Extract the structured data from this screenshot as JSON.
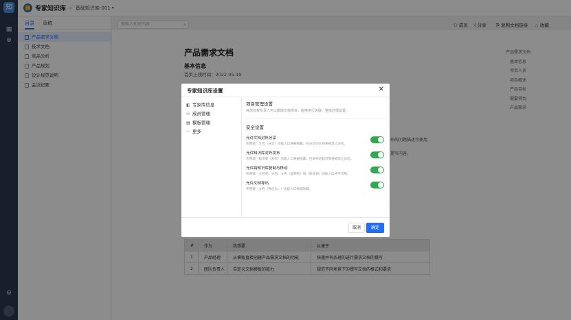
{
  "app": {
    "title": "专家知识库",
    "breadcrumb": "基础知识库-001",
    "caret": "▾"
  },
  "rail": {
    "logo": "知",
    "icons": [
      "grid-icon",
      "plus-icon",
      "settings-icon"
    ]
  },
  "leftpanel": {
    "tabs": [
      "目录",
      "草稿"
    ],
    "items": [
      "产品需求文档",
      "技术文档",
      "竞品分析",
      "产品规划",
      "设计规范说明",
      "会议纪要"
    ]
  },
  "toolbar": {
    "search_placeholder": "搜索入知识内容",
    "buttons": [
      "成员",
      "分享",
      "复制文档链接",
      "收藏"
    ]
  },
  "doc": {
    "title": "产品需求文档",
    "section": "基本信息",
    "meta": "首页上线时间：2022-05-19",
    "frag1": "外的问题描述可使用",
    "frag2": "提写内容。",
    "toc": [
      "产品需求文档",
      "基本信息",
      "项目人员",
      "项目概述",
      "产品目标",
      "需要得到",
      "产品需求"
    ],
    "table": {
      "headers": [
        "#",
        "作为",
        "我想要",
        "以便于"
      ],
      "rows": [
        [
          "1",
          "产品经理",
          "从模板直接创建产品需求文档的功能",
          "快速并有条理的进行需求文档的撰写"
        ],
        [
          "2",
          "团队负责人",
          "自定义文档模板的能力",
          "规范不同场景下的撰写文档的格式和要求"
        ]
      ]
    }
  },
  "modal": {
    "title": "专家知识库设置",
    "close": "✕",
    "side": [
      {
        "icon": "info-icon",
        "glyph": "◧",
        "label": "专家库信息"
      },
      {
        "icon": "users-icon",
        "glyph": "⚇",
        "label": "成员管理"
      },
      {
        "icon": "template-icon",
        "glyph": "▤",
        "label": "模板管理"
      },
      {
        "icon": "more-icon",
        "glyph": "···",
        "label": "更多"
      }
    ],
    "project": {
      "title": "项目管理设置",
      "desc": "目前仅有负责人可以删除文档项目，能够进行关联、整体处理设置。"
    },
    "security": {
      "title": "安全设置",
      "items": [
        {
          "title": "允许文档对外分享",
          "desc": "作用域：文档（分享）功能入口将被隐藏，已分享的文档将被禁止访问。",
          "on": true
        },
        {
          "title": "允许知识库对外发布",
          "desc": "作用域：知识库（发布）功能入口将被隐藏，已发布的知识库将被禁止访问。",
          "on": true
        },
        {
          "title": "允许跨知识库复制与移动",
          "desc": "作用域：文档夹、文档、文件（复制到）和（移动到）功能入口将不可用。",
          "on": true
        },
        {
          "title": "允许文档导出",
          "desc": "作用域：文档（导出为...）功能入口将被隐藏。",
          "on": true
        }
      ]
    },
    "cancel": "取消",
    "ok": "确定"
  }
}
